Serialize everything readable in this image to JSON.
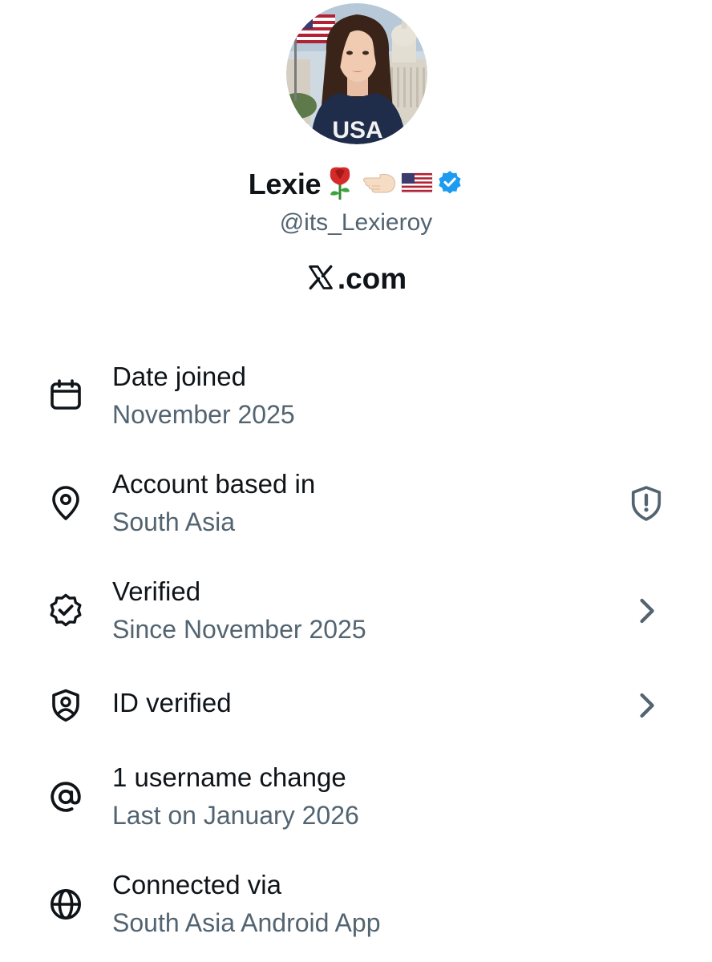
{
  "profile": {
    "display_name": "Lexie",
    "name_emojis": [
      "rose",
      "backhand-index-pointing-left",
      "us-flag"
    ],
    "verified_badge_color": "#1d9bf0",
    "handle": "@its_Lexieroy",
    "site_label": ".com",
    "avatar_text": "USA"
  },
  "info": {
    "date_joined": {
      "title": "Date joined",
      "value": "November 2025",
      "icon": "calendar-icon"
    },
    "account_based": {
      "title": "Account based in",
      "value": "South Asia",
      "icon": "location-pin-icon",
      "right_icon": "shield-alert-icon"
    },
    "verified": {
      "title": "Verified",
      "value": "Since November 2025",
      "icon": "verified-badge-icon",
      "right_icon": "chevron-right-icon"
    },
    "id_verified": {
      "title": "ID verified",
      "icon": "id-shield-icon",
      "right_icon": "chevron-right-icon"
    },
    "username_change": {
      "title": "1 username change",
      "value": "Last on January 2026",
      "icon": "at-sign-icon"
    },
    "connected_via": {
      "title": "Connected via",
      "value": "South Asia Android App",
      "icon": "globe-icon"
    }
  },
  "colors": {
    "primary_text": "#0f1419",
    "secondary_text": "#536471",
    "icon": "#0f1419",
    "verified_blue": "#1d9bf0"
  }
}
